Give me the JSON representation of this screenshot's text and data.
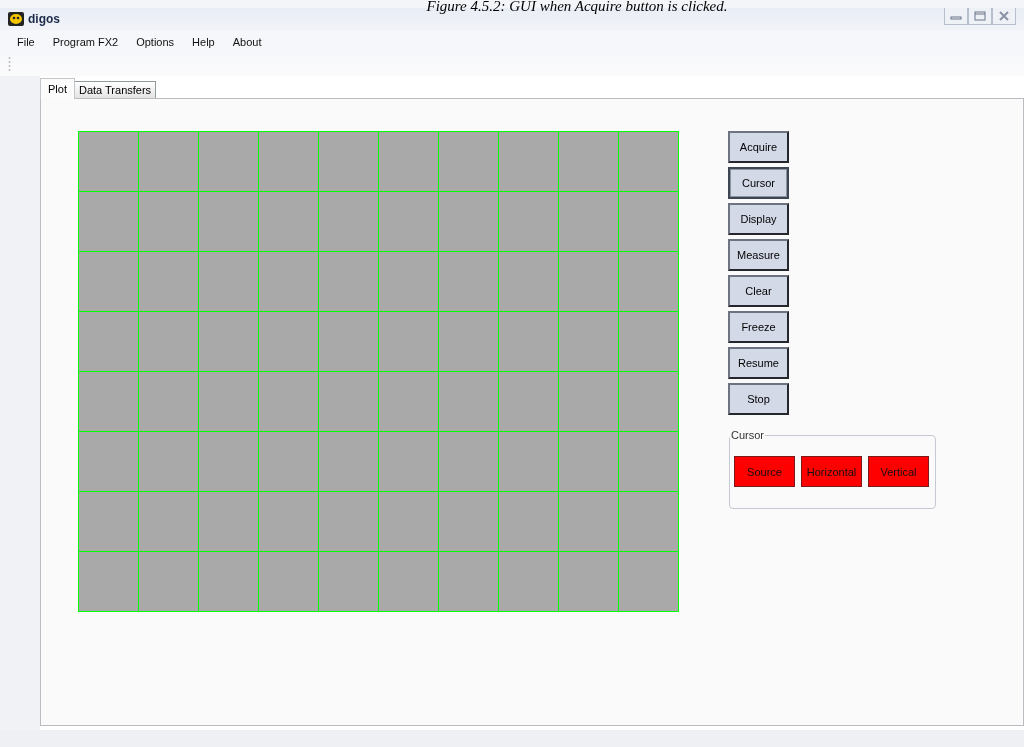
{
  "caption": "Figure 4.5.2: GUI when Acquire button is clicked.",
  "window": {
    "title": "digos"
  },
  "menu": [
    "File",
    "Program FX2",
    "Options",
    "Help",
    "About"
  ],
  "tabs": [
    {
      "label": "Plot",
      "selected": true
    },
    {
      "label": "Data Transfers",
      "selected": false
    }
  ],
  "buttons": [
    {
      "label": "Acquire",
      "selected": false
    },
    {
      "label": "Cursor",
      "selected": true
    },
    {
      "label": "Display",
      "selected": false
    },
    {
      "label": "Measure",
      "selected": false
    },
    {
      "label": "Clear",
      "selected": false
    },
    {
      "label": "Freeze",
      "selected": false
    },
    {
      "label": "Resume",
      "selected": false
    },
    {
      "label": "Stop",
      "selected": false
    }
  ],
  "cursor_group": {
    "title": "Cursor",
    "buttons": [
      {
        "label": "Source",
        "color": "#ff0000"
      },
      {
        "label": "Horizontal",
        "color": "#ff0000"
      },
      {
        "label": "Vertical",
        "color": "#ff0000"
      }
    ]
  }
}
